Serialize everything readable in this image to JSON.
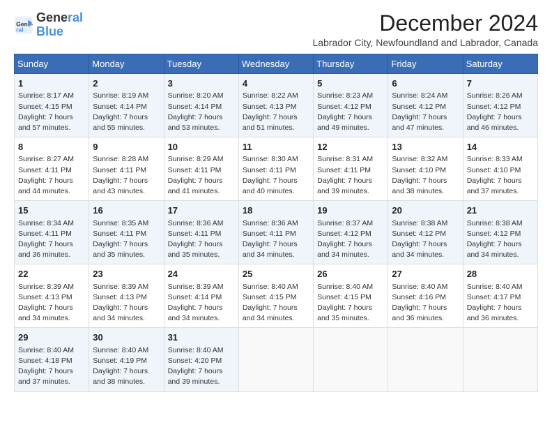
{
  "logo": {
    "line1": "General",
    "line2": "Blue"
  },
  "title": "December 2024",
  "subtitle": "Labrador City, Newfoundland and Labrador, Canada",
  "days_of_week": [
    "Sunday",
    "Monday",
    "Tuesday",
    "Wednesday",
    "Thursday",
    "Friday",
    "Saturday"
  ],
  "weeks": [
    [
      {
        "day": "1",
        "info": "Sunrise: 8:17 AM\nSunset: 4:15 PM\nDaylight: 7 hours\nand 57 minutes."
      },
      {
        "day": "2",
        "info": "Sunrise: 8:19 AM\nSunset: 4:14 PM\nDaylight: 7 hours\nand 55 minutes."
      },
      {
        "day": "3",
        "info": "Sunrise: 8:20 AM\nSunset: 4:14 PM\nDaylight: 7 hours\nand 53 minutes."
      },
      {
        "day": "4",
        "info": "Sunrise: 8:22 AM\nSunset: 4:13 PM\nDaylight: 7 hours\nand 51 minutes."
      },
      {
        "day": "5",
        "info": "Sunrise: 8:23 AM\nSunset: 4:12 PM\nDaylight: 7 hours\nand 49 minutes."
      },
      {
        "day": "6",
        "info": "Sunrise: 8:24 AM\nSunset: 4:12 PM\nDaylight: 7 hours\nand 47 minutes."
      },
      {
        "day": "7",
        "info": "Sunrise: 8:26 AM\nSunset: 4:12 PM\nDaylight: 7 hours\nand 46 minutes."
      }
    ],
    [
      {
        "day": "8",
        "info": "Sunrise: 8:27 AM\nSunset: 4:11 PM\nDaylight: 7 hours\nand 44 minutes."
      },
      {
        "day": "9",
        "info": "Sunrise: 8:28 AM\nSunset: 4:11 PM\nDaylight: 7 hours\nand 43 minutes."
      },
      {
        "day": "10",
        "info": "Sunrise: 8:29 AM\nSunset: 4:11 PM\nDaylight: 7 hours\nand 41 minutes."
      },
      {
        "day": "11",
        "info": "Sunrise: 8:30 AM\nSunset: 4:11 PM\nDaylight: 7 hours\nand 40 minutes."
      },
      {
        "day": "12",
        "info": "Sunrise: 8:31 AM\nSunset: 4:11 PM\nDaylight: 7 hours\nand 39 minutes."
      },
      {
        "day": "13",
        "info": "Sunrise: 8:32 AM\nSunset: 4:10 PM\nDaylight: 7 hours\nand 38 minutes."
      },
      {
        "day": "14",
        "info": "Sunrise: 8:33 AM\nSunset: 4:10 PM\nDaylight: 7 hours\nand 37 minutes."
      }
    ],
    [
      {
        "day": "15",
        "info": "Sunrise: 8:34 AM\nSunset: 4:11 PM\nDaylight: 7 hours\nand 36 minutes."
      },
      {
        "day": "16",
        "info": "Sunrise: 8:35 AM\nSunset: 4:11 PM\nDaylight: 7 hours\nand 35 minutes."
      },
      {
        "day": "17",
        "info": "Sunrise: 8:36 AM\nSunset: 4:11 PM\nDaylight: 7 hours\nand 35 minutes."
      },
      {
        "day": "18",
        "info": "Sunrise: 8:36 AM\nSunset: 4:11 PM\nDaylight: 7 hours\nand 34 minutes."
      },
      {
        "day": "19",
        "info": "Sunrise: 8:37 AM\nSunset: 4:12 PM\nDaylight: 7 hours\nand 34 minutes."
      },
      {
        "day": "20",
        "info": "Sunrise: 8:38 AM\nSunset: 4:12 PM\nDaylight: 7 hours\nand 34 minutes."
      },
      {
        "day": "21",
        "info": "Sunrise: 8:38 AM\nSunset: 4:12 PM\nDaylight: 7 hours\nand 34 minutes."
      }
    ],
    [
      {
        "day": "22",
        "info": "Sunrise: 8:39 AM\nSunset: 4:13 PM\nDaylight: 7 hours\nand 34 minutes."
      },
      {
        "day": "23",
        "info": "Sunrise: 8:39 AM\nSunset: 4:13 PM\nDaylight: 7 hours\nand 34 minutes."
      },
      {
        "day": "24",
        "info": "Sunrise: 8:39 AM\nSunset: 4:14 PM\nDaylight: 7 hours\nand 34 minutes."
      },
      {
        "day": "25",
        "info": "Sunrise: 8:40 AM\nSunset: 4:15 PM\nDaylight: 7 hours\nand 34 minutes."
      },
      {
        "day": "26",
        "info": "Sunrise: 8:40 AM\nSunset: 4:15 PM\nDaylight: 7 hours\nand 35 minutes."
      },
      {
        "day": "27",
        "info": "Sunrise: 8:40 AM\nSunset: 4:16 PM\nDaylight: 7 hours\nand 36 minutes."
      },
      {
        "day": "28",
        "info": "Sunrise: 8:40 AM\nSunset: 4:17 PM\nDaylight: 7 hours\nand 36 minutes."
      }
    ],
    [
      {
        "day": "29",
        "info": "Sunrise: 8:40 AM\nSunset: 4:18 PM\nDaylight: 7 hours\nand 37 minutes."
      },
      {
        "day": "30",
        "info": "Sunrise: 8:40 AM\nSunset: 4:19 PM\nDaylight: 7 hours\nand 38 minutes."
      },
      {
        "day": "31",
        "info": "Sunrise: 8:40 AM\nSunset: 4:20 PM\nDaylight: 7 hours\nand 39 minutes."
      },
      {
        "day": "",
        "info": ""
      },
      {
        "day": "",
        "info": ""
      },
      {
        "day": "",
        "info": ""
      },
      {
        "day": "",
        "info": ""
      }
    ]
  ]
}
